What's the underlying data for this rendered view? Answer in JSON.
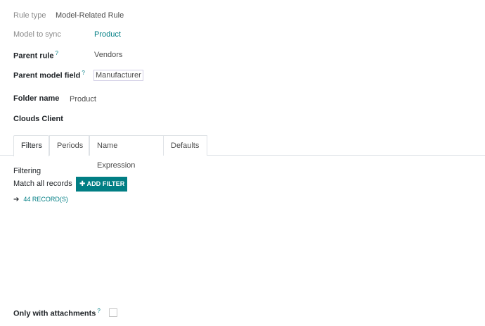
{
  "form": {
    "rule_type_label": "Rule type",
    "rule_type_value": "Model-Related Rule",
    "model_to_sync_label": "Model to sync",
    "model_to_sync_value": "Product",
    "parent_rule_label": "Parent rule",
    "parent_rule_value": "Vendors",
    "parent_model_field_label": "Parent model field",
    "parent_model_field_value": "Manufacturer",
    "folder_name_label": "Folder name",
    "folder_name_value": "Product",
    "clouds_client_label": "Clouds Client",
    "tooltip_mark": "?"
  },
  "tabs": [
    {
      "label": "Filters",
      "active": true
    },
    {
      "label": "Periods",
      "active": false
    },
    {
      "label": "Name Expression",
      "active": false
    },
    {
      "label": "Defaults",
      "active": false
    }
  ],
  "filters": {
    "section_title": "Filtering",
    "match_prefix": "Match",
    "match_all": "all",
    "match_suffix": "records",
    "add_filter_label": "ADD FILTER",
    "add_filter_icon": "plus-icon",
    "records_icon": "arrow-right-icon",
    "records_label": "44 RECORD(S)"
  },
  "attachments": {
    "label": "Only with attachments",
    "checked": false
  },
  "colors": {
    "accent": "#017e84"
  }
}
